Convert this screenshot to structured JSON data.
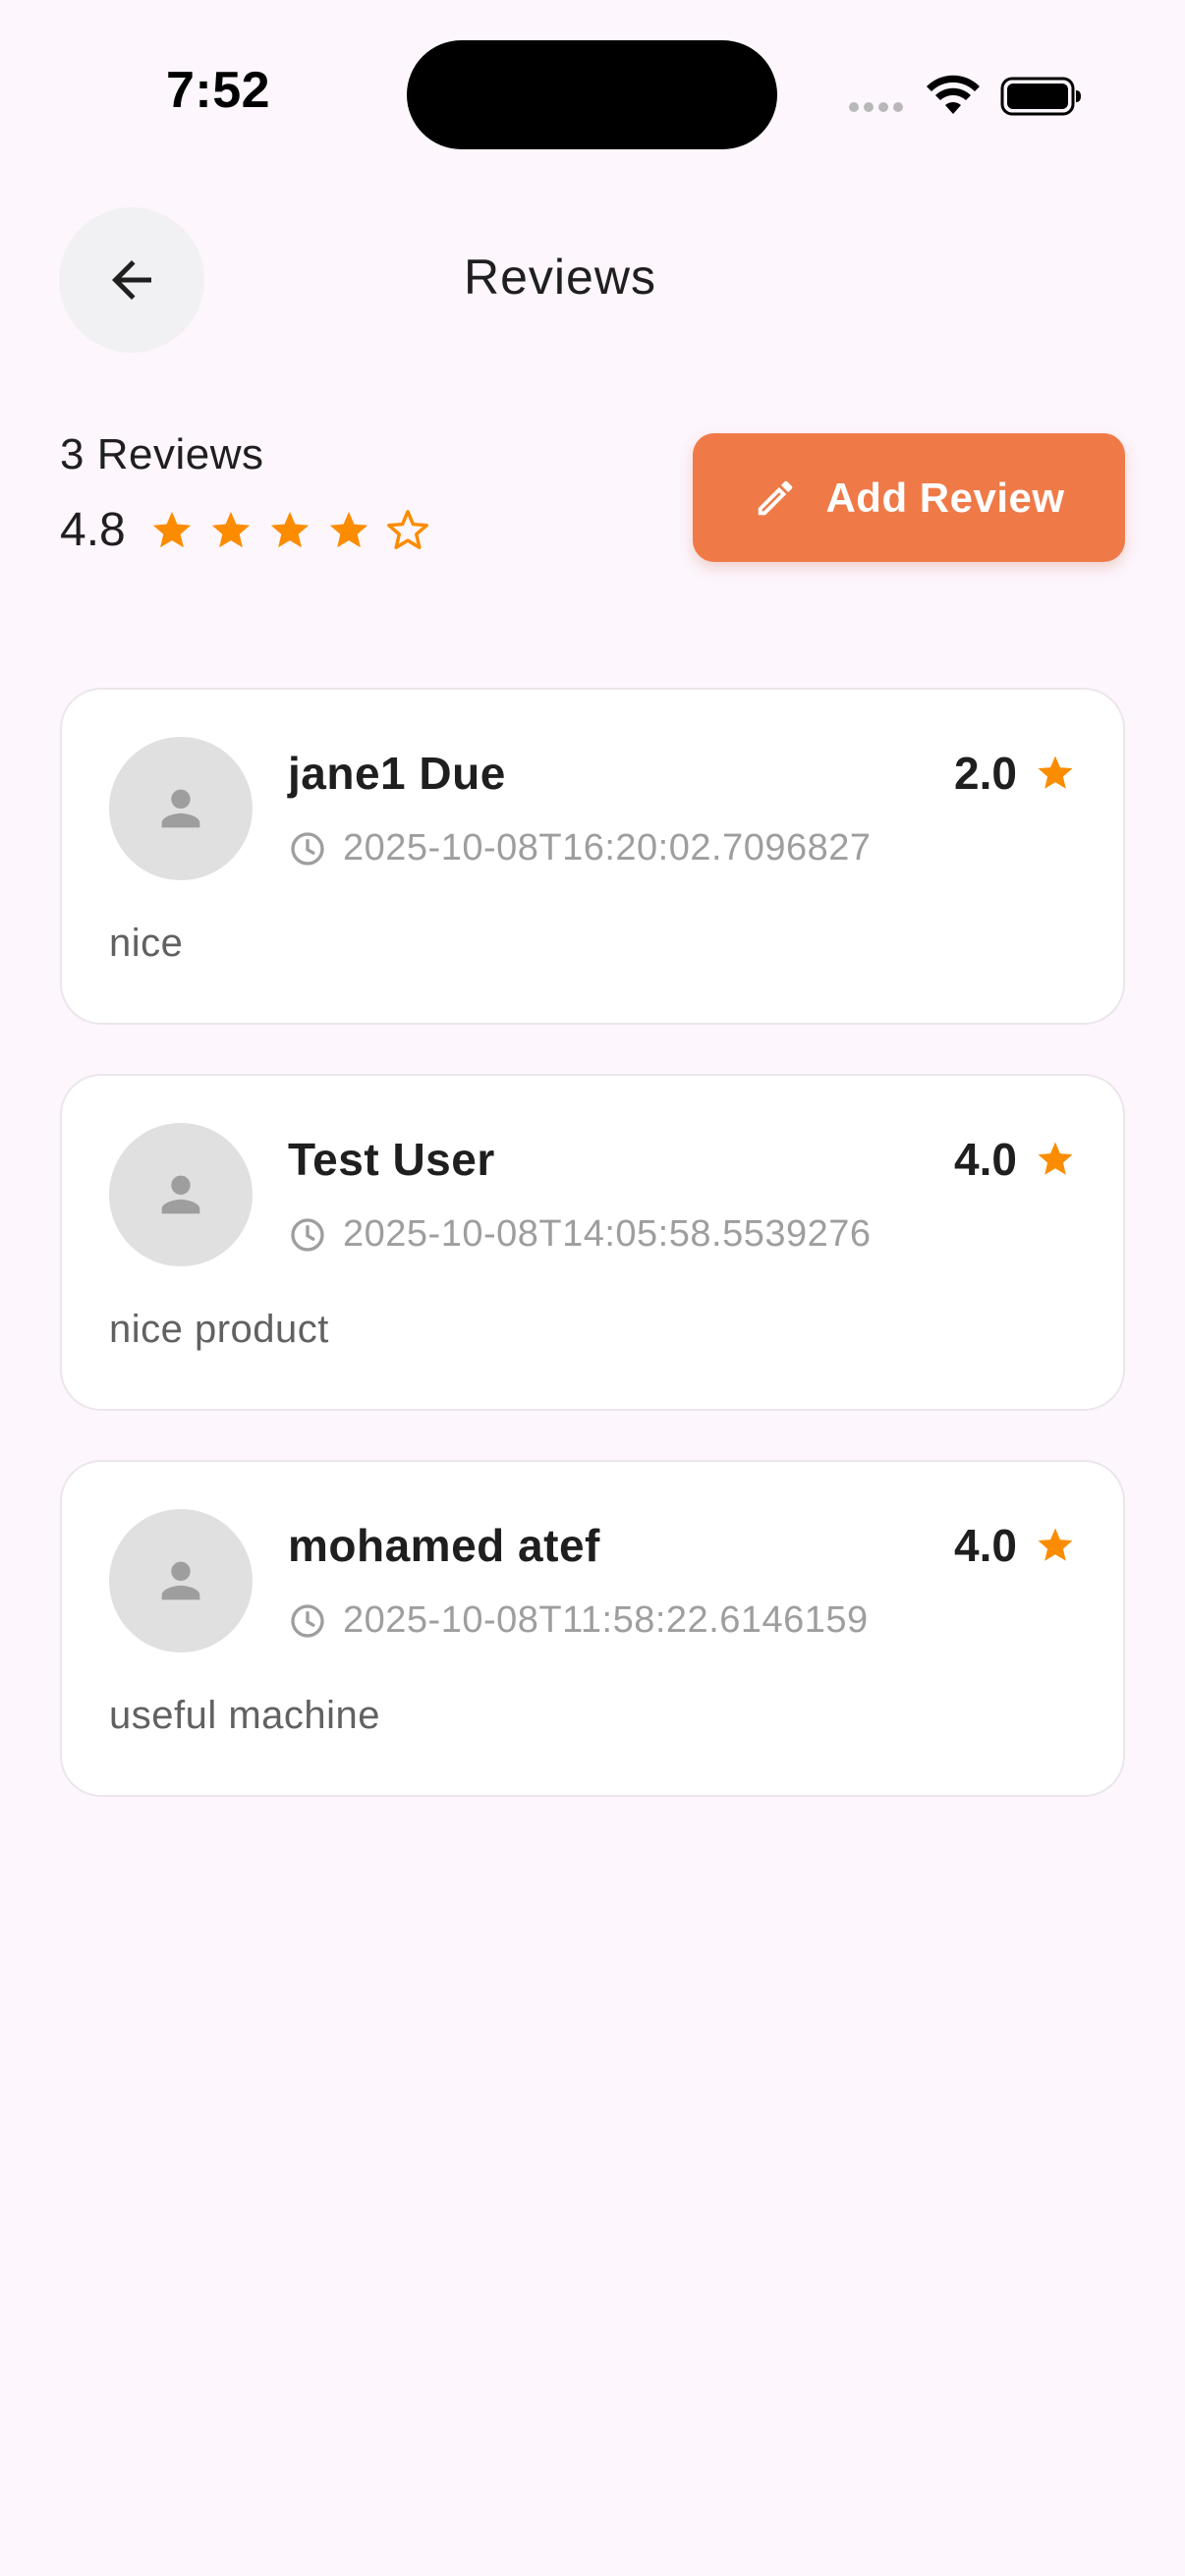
{
  "status_bar": {
    "time": "7:52"
  },
  "header": {
    "title": "Reviews",
    "back_icon": "arrow-left-icon"
  },
  "summary": {
    "count_label": "3 Reviews",
    "average": "4.8",
    "stars_filled": 4,
    "stars_total": 5,
    "add_review_label": "Add Review",
    "add_review_icon": "pencil-icon"
  },
  "reviews": [
    {
      "name": "jane1 Due",
      "rating": "2.0",
      "date": "2025-10-08T16:20:02.7096827",
      "text": "nice"
    },
    {
      "name": "Test User",
      "rating": "4.0",
      "date": "2025-10-08T14:05:58.5539276",
      "text": "nice product"
    },
    {
      "name": "mohamed atef",
      "rating": "4.0",
      "date": "2025-10-08T11:58:22.6146159",
      "text": "useful machine"
    }
  ],
  "colors": {
    "background": "#FDF6FD",
    "accent": "#EF7A48",
    "star": "#FB8C00",
    "muted_text": "#9E9E9E"
  }
}
